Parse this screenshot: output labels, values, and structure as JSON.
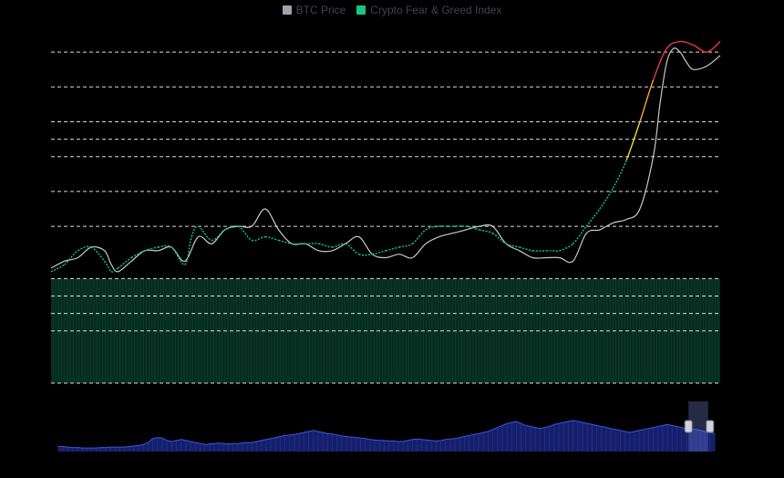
{
  "legend": {
    "items": [
      {
        "label": "BTC Price",
        "color": "#9ea3ad"
      },
      {
        "label": "Crypto Fear & Greed Index",
        "color": "#16c784"
      }
    ]
  },
  "chart_data": {
    "type": "line",
    "grid": true,
    "legend_placement": "top-center",
    "price_ylim": [
      0,
      100
    ],
    "index_ylim": [
      0,
      100
    ],
    "gridlines": [
      0,
      15,
      20,
      25,
      30,
      45,
      55,
      65,
      70,
      75,
      85,
      95
    ],
    "band": {
      "from": 0,
      "to": 30,
      "color": "#16c784"
    },
    "series": [
      {
        "name": "BTC Price",
        "color": "#c9c9c9",
        "x": [
          0,
          2,
          4,
          6,
          8,
          9,
          10,
          12,
          14,
          16,
          18,
          20,
          22,
          24,
          26,
          28,
          30,
          32,
          34,
          36,
          38,
          40,
          42,
          44,
          46,
          48,
          50,
          52,
          54,
          56,
          58,
          60,
          62,
          64,
          66,
          68,
          70,
          72,
          74,
          76,
          78,
          80,
          82,
          84,
          86,
          88,
          90,
          91,
          92,
          93,
          94,
          95,
          96,
          98,
          100
        ],
        "values": [
          33,
          35,
          36,
          39,
          38,
          34,
          32,
          35,
          38,
          38,
          39,
          35,
          42,
          40,
          44,
          45,
          45,
          50,
          44,
          40,
          40,
          38,
          38,
          40,
          42,
          37,
          36,
          37,
          36,
          40,
          42,
          43,
          44,
          45,
          45,
          40,
          38,
          36,
          36,
          36,
          35,
          43,
          44,
          46,
          47,
          50,
          65,
          80,
          92,
          96,
          95,
          92,
          90,
          91,
          94
        ]
      },
      {
        "name": "Crypto Fear & Greed Index",
        "color": "#16c784",
        "x": [
          0,
          2,
          4,
          6,
          8,
          9,
          10,
          12,
          14,
          16,
          18,
          20,
          21,
          22,
          24,
          26,
          28,
          30,
          32,
          34,
          36,
          38,
          40,
          42,
          44,
          46,
          48,
          50,
          52,
          54,
          56,
          58,
          60,
          62,
          64,
          66,
          68,
          70,
          72,
          74,
          75,
          76,
          78,
          80,
          82,
          84,
          86,
          88,
          90,
          92,
          94,
          96,
          98,
          100
        ],
        "values": [
          32,
          34,
          38,
          39,
          35,
          32,
          33,
          36,
          38,
          39,
          39,
          34,
          42,
          45,
          41,
          44,
          45,
          41,
          42,
          41,
          40,
          40,
          40,
          39,
          40,
          37,
          37,
          38,
          39,
          40,
          44,
          45,
          45,
          45,
          44,
          43,
          40,
          39,
          38,
          38,
          38,
          38,
          40,
          45,
          50,
          56,
          64,
          75,
          87,
          96,
          98,
          97,
          95,
          98
        ]
      }
    ],
    "navigator": {
      "values": [
        10,
        10,
        9,
        8,
        8,
        7,
        7,
        7,
        7,
        8,
        8,
        9,
        9,
        9,
        9,
        10,
        11,
        12,
        14,
        18,
        26,
        28,
        27,
        22,
        20,
        22,
        24,
        22,
        20,
        18,
        16,
        14,
        15,
        16,
        17,
        16,
        15,
        16,
        16,
        17,
        18,
        18,
        20,
        22,
        24,
        26,
        28,
        30,
        32,
        33,
        34,
        36,
        38,
        40,
        42,
        40,
        38,
        36,
        35,
        33,
        31,
        30,
        29,
        28,
        27,
        26,
        24,
        23,
        22,
        22,
        21,
        21,
        20,
        20,
        22,
        24,
        25,
        24,
        23,
        22,
        21,
        22,
        24,
        25,
        26,
        28,
        30,
        32,
        34,
        36,
        38,
        40,
        44,
        48,
        52,
        56,
        58,
        60,
        56,
        52,
        50,
        48,
        46,
        48,
        50,
        54,
        56,
        58,
        60,
        62,
        60,
        58,
        56,
        54,
        52,
        50,
        48,
        46,
        44,
        42,
        40,
        38,
        40,
        42,
        44,
        46,
        48,
        50,
        52,
        54,
        52,
        50,
        48,
        46,
        45,
        44,
        42,
        40,
        38,
        36
      ],
      "range": [
        0.96,
        0.99
      ]
    }
  }
}
